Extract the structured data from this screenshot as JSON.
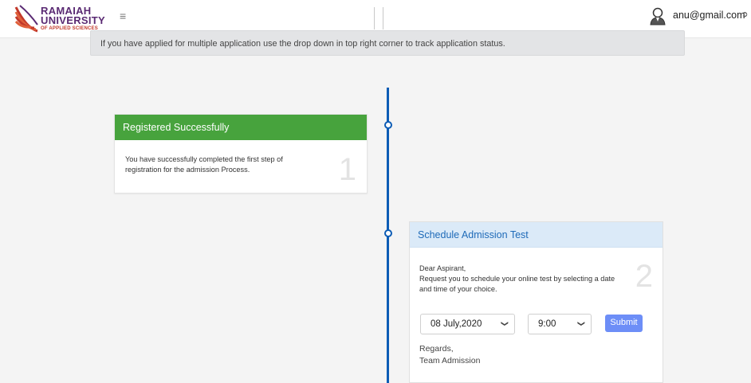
{
  "header": {
    "logo": {
      "line1": "RAMAIAH",
      "line2": "UNIVERSITY",
      "line3": "OF APPLIED SCIENCES"
    },
    "menu_icon": "hamburger-icon",
    "user_email": "anu@gmail.com",
    "logout_icon": "logout-icon"
  },
  "info_message": "If you have applied for multiple application use the drop down in top right corner to track application status.",
  "timeline": {
    "color": "#0d5cb5",
    "steps": [
      {
        "title": "Registered Successfully",
        "body": "You have successfully completed the first step of registration for the admission Process.",
        "number": "1",
        "header_color": "#47a33d"
      },
      {
        "title": "Schedule Admission Test",
        "greeting": "Dear Aspirant,",
        "body": "Request you to schedule your online test by selecting a date and time of your choice.",
        "number": "2",
        "header_color": "#dbeaf8",
        "date_value": "08 July,2020",
        "time_value": "9:00",
        "submit_label": "Submit",
        "regards": "Regards,",
        "team": "Team Admission"
      }
    ]
  }
}
